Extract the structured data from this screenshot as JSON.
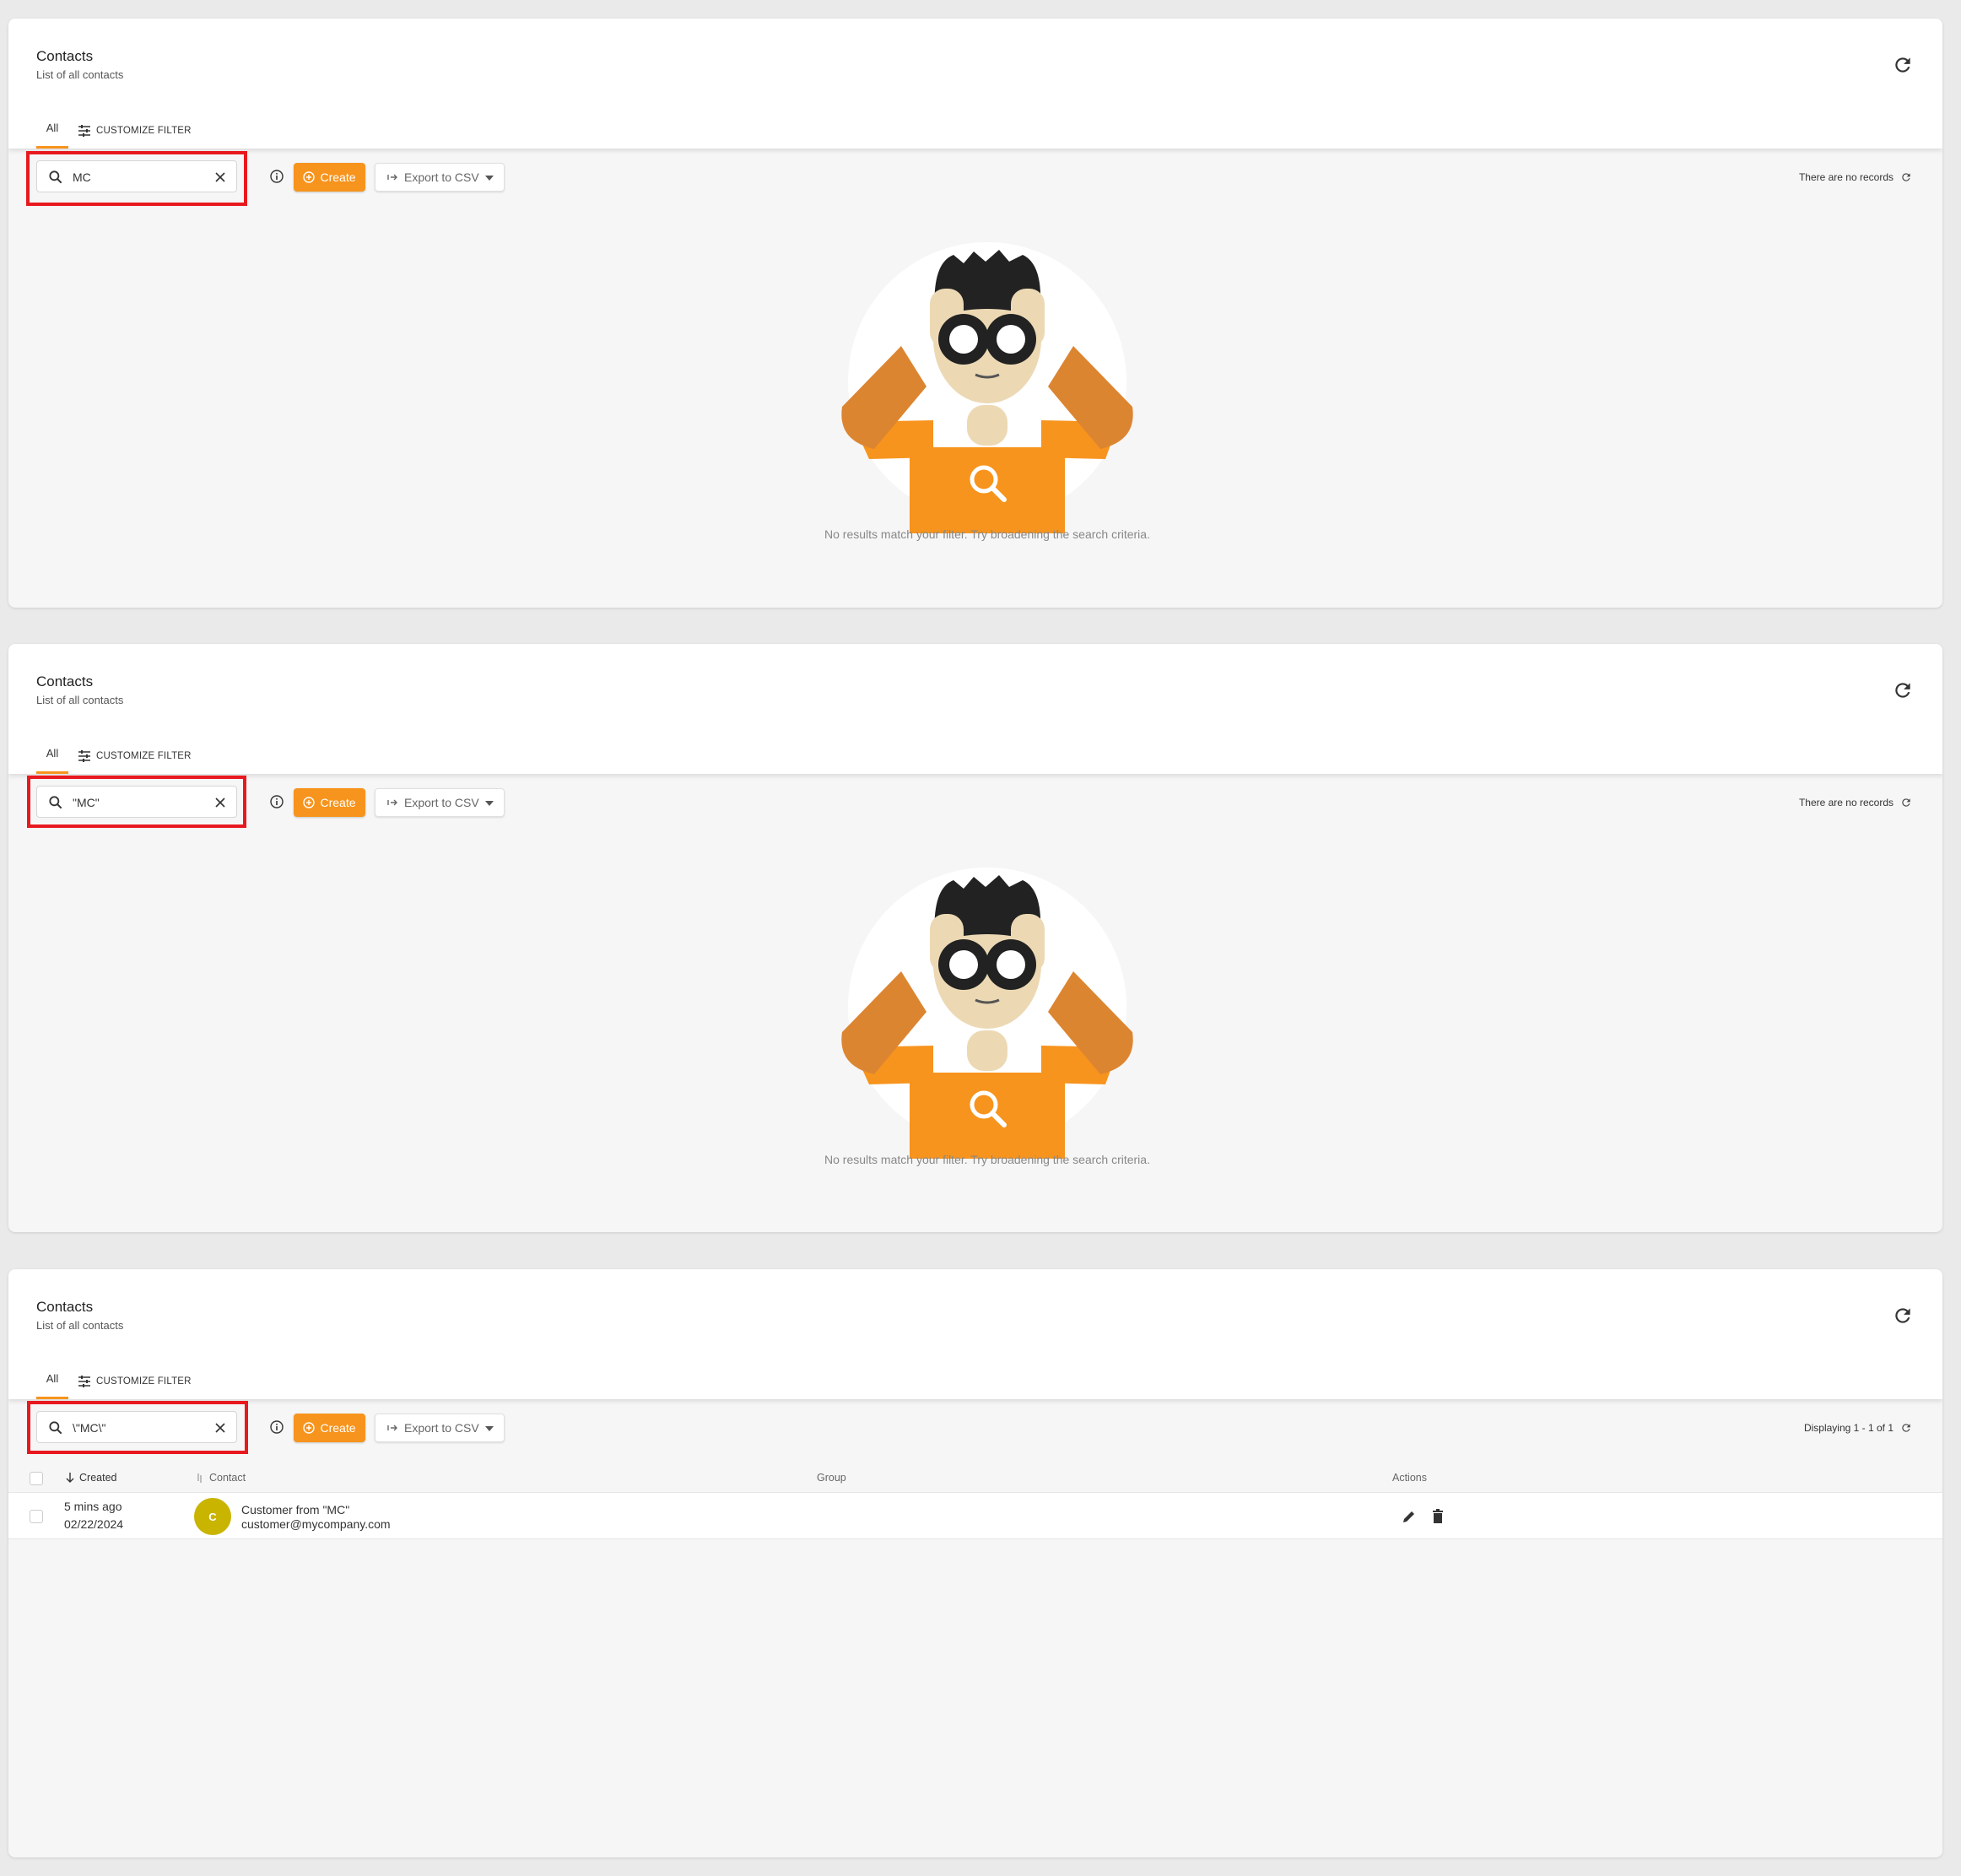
{
  "panels": [
    {
      "title": "Contacts",
      "subtitle": "List of all contacts",
      "tab_all": "All",
      "tab_filter": "CUSTOMIZE FILTER",
      "search_value": "MC",
      "create_label": "Create",
      "export_label": "Export to CSV",
      "status": "There are no records",
      "empty_message": "No results match your filter. Try broadening the search criteria."
    },
    {
      "title": "Contacts",
      "subtitle": "List of all contacts",
      "tab_all": "All",
      "tab_filter": "CUSTOMIZE FILTER",
      "search_value": "\"MC\"",
      "create_label": "Create",
      "export_label": "Export to CSV",
      "status": "There are no records",
      "empty_message": "No results match your filter. Try broadening the search criteria."
    },
    {
      "title": "Contacts",
      "subtitle": "List of all contacts",
      "tab_all": "All",
      "tab_filter": "CUSTOMIZE FILTER",
      "search_value": "\\\"MC\\\"",
      "create_label": "Create",
      "export_label": "Export to CSV",
      "status": "Displaying 1 - 1 of 1",
      "table": {
        "columns": [
          "Created",
          "Contact",
          "Group",
          "Actions"
        ],
        "rows": [
          {
            "created_relative": "5 mins ago",
            "created_date": "02/22/2024",
            "avatar_letter": "C",
            "name": "Customer from \"MC\"",
            "email": "customer@mycompany.com"
          }
        ]
      }
    }
  ],
  "colors": {
    "accent": "#f7941d",
    "highlight_box": "#e8191e",
    "avatar": "#c9b400"
  },
  "icons": [
    "refresh-icon",
    "filter-icon",
    "search-icon",
    "clear-icon",
    "info-icon",
    "add-circle-icon",
    "export-arrow-icon",
    "chevron-down-icon",
    "edit-icon",
    "delete-icon",
    "sort-down-icon",
    "sort-icon"
  ]
}
